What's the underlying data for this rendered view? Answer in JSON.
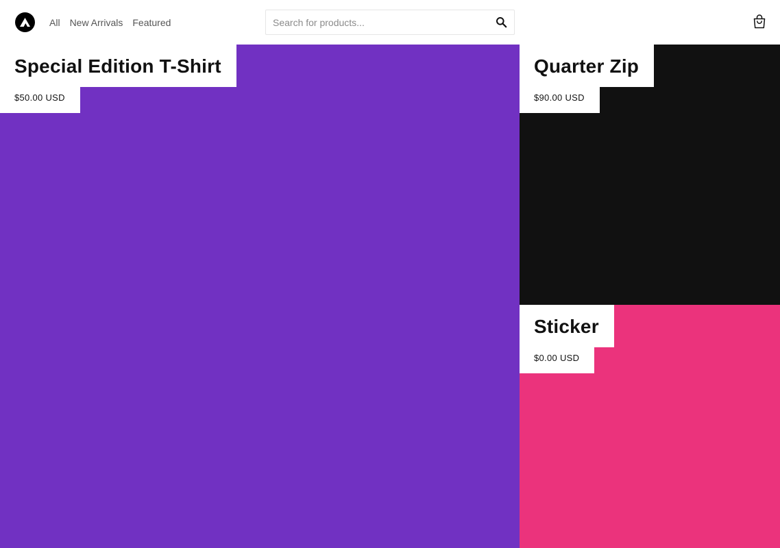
{
  "header": {
    "logo_icon": "store-logo-icon",
    "nav": [
      {
        "label": "All"
      },
      {
        "label": "New Arrivals"
      },
      {
        "label": "Featured"
      }
    ],
    "search": {
      "placeholder": "Search for products...",
      "value": "",
      "icon": "search-icon"
    },
    "cart_icon": "shopping-bag-icon"
  },
  "products": [
    {
      "title": "Special Edition T-Shirt",
      "price": "$50.00 USD",
      "color": "#7131c2"
    },
    {
      "title": "Quarter Zip",
      "price": "$90.00 USD",
      "color": "#111111"
    },
    {
      "title": "Sticker",
      "price": "$0.00 USD",
      "color": "#eb337c"
    }
  ]
}
